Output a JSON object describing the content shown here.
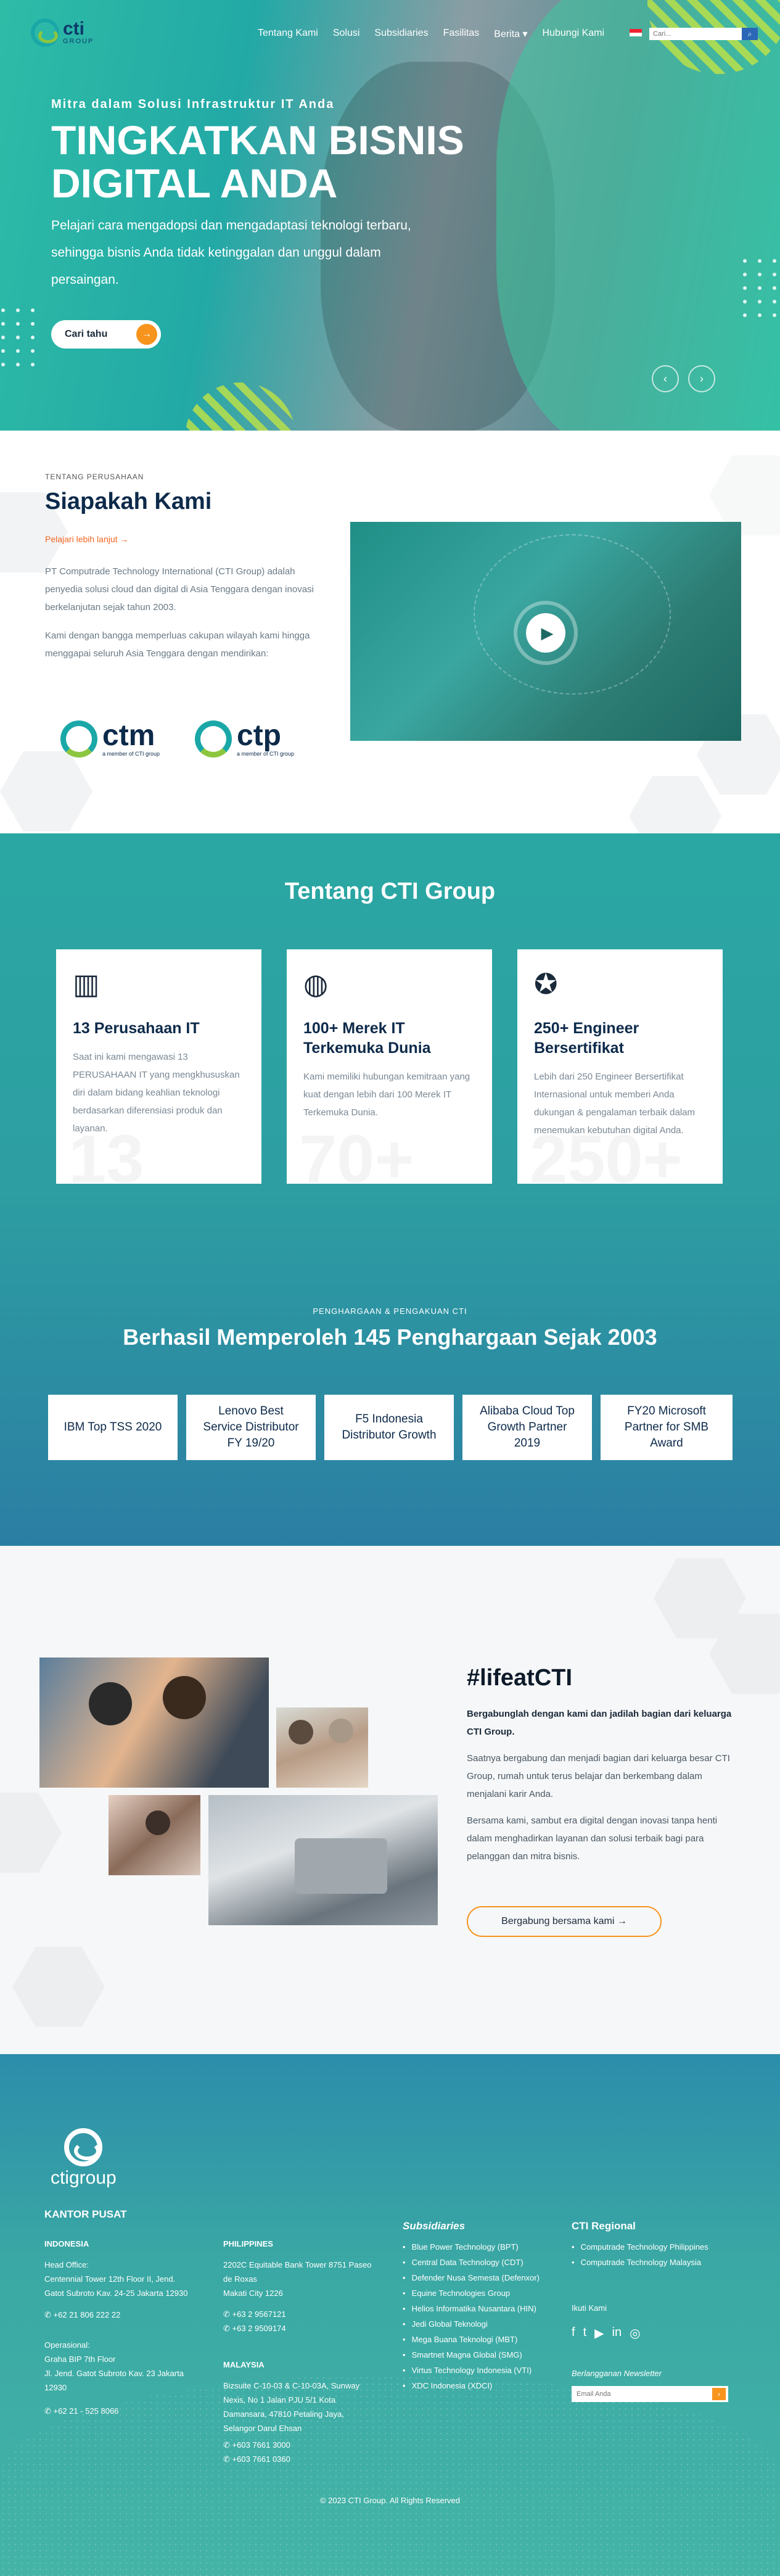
{
  "header": {
    "logo_text": "cti",
    "logo_sub": "GROUP",
    "nav": [
      "Tentang Kami",
      "Solusi",
      "Subsidiaries",
      "Fasilitas",
      "Berita ▾",
      "Hubungi Kami"
    ],
    "search_placeholder": "Cari...",
    "search_icon": "search-icon"
  },
  "hero": {
    "subtitle": "Mitra dalam Solusi Infrastruktur IT Anda",
    "title": "TINGKATKAN BISNIS DIGITAL ANDA",
    "description": "Pelajari cara mengadopsi dan mengadaptasi teknologi terbaru, sehingga bisnis Anda tidak ketinggalan dan unggul dalam persaingan.",
    "button": "Cari tahu",
    "prev": "‹",
    "next": "›"
  },
  "about": {
    "label": "TENTANG PERUSAHAAN",
    "title": "Siapakah Kami",
    "link": "Pelajari lebih lanjut  →",
    "p1": "PT Computrade Technology International (CTI Group) adalah penyedia solusi cloud dan digital di Asia Tenggara dengan inovasi berkelanjutan sejak tahun 2003.",
    "p2": "Kami dengan bangga memperluas cakupan wilayah kami hingga menggapai seluruh Asia Tenggara dengan mendirikan:",
    "logos": [
      {
        "name": "ctm",
        "sub": "a member of CTI group"
      },
      {
        "name": "ctp",
        "sub": "a member of CTI group"
      }
    ]
  },
  "stats": {
    "title": "Tentang CTI Group",
    "cards": [
      {
        "icon": "building-icon",
        "title": "13 Perusahaan IT",
        "text": "Saat ini kami mengawasi 13 PERUSAHAAN IT yang mengkhususkan diri dalam bidang keahlian teknologi berdasarkan diferensiasi produk dan layanan.",
        "bg": "13"
      },
      {
        "icon": "globe-icon",
        "title": "100+ Merek IT Terkemuka Dunia",
        "text": "Kami memiliki hubungan kemitraan yang kuat dengan lebih dari 100 Merek IT Terkemuka Dunia.",
        "bg": "70+"
      },
      {
        "icon": "award-icon",
        "title": "250+ Engineer Bersertifikat",
        "text": "Lebih dari 250 Engineer Bersertifikat Internasional untuk memberi Anda dukungan & pengalaman terbaik dalam menemukan kebutuhan digital Anda.",
        "bg": "250+"
      }
    ],
    "awards_label": "PENGHARGAAN & PENGAKUAN CTI",
    "awards_title": "Berhasil Memperoleh 145 Penghargaan Sejak 2003",
    "awards": [
      "IBM Top TSS 2020",
      "Lenovo Best Service Distributor FY 19/20",
      "F5 Indonesia Distributor Growth",
      "Alibaba Cloud Top Growth Partner 2019",
      "FY20 Microsoft Partner for SMB Award"
    ]
  },
  "life": {
    "title": "#lifeatCTI",
    "bold": "Bergabunglah dengan kami dan jadilah bagian dari keluarga CTI Group.",
    "p1": "Saatnya bergabung dan menjadi bagian dari keluarga besar CTI Group, rumah untuk terus belajar dan berkembang dalam menjalani karir Anda.",
    "p2": "Bersama kami, sambut era digital dengan inovasi tanpa henti dalam menghadirkan layanan dan solusi terbaik bagi para pelanggan dan mitra bisnis.",
    "button": "Bergabung bersama kami   →"
  },
  "footer": {
    "logo": "ctigroup",
    "kantor": "KANTOR PUSAT",
    "indonesia": {
      "label": "INDONESIA",
      "head": "Head Office:\nCentennial Tower 12th Floor II, Jend. Gatot Subroto Kav. 24-25 Jakarta 12930",
      "phone": "+62 21 806 222 22",
      "ops": "Operasional:\nGraha BIP 7th Floor\nJl. Jend. Gatot Subroto Kav. 23 Jakarta 12930",
      "phone2": "+62 21 - 525 8066"
    },
    "philippines": {
      "label": "PHILIPPINES",
      "addr": "2202C Equitable Bank Tower 8751 Paseo de Roxas\nMakati City 1226",
      "p1": "+63 2 9567121",
      "p2": "+63 2 9509174"
    },
    "malaysia": {
      "label": "MALAYSIA",
      "addr": "Bizsuite C-10-03 & C-10-03A, Sunway Nexis, No 1 Jalan PJU 5/1 Kota Damansara, 47810 Petaling Jaya, Selangor Darul Ehsan",
      "p1": "+603 7661 3000",
      "p2": "+603 7661 0360"
    },
    "subsidiaries_title": "Subsidiaries",
    "subsidiaries": [
      "Blue Power Technology (BPT)",
      "Central Data Technology (CDT)",
      "Defender Nusa Semesta (Defenxor)",
      "Equine Technologies Group",
      "Helios Informatika Nusantara (HIN)",
      "Jedi Global Teknologi",
      "Mega Buana Teknologi (MBT)",
      "Smartnet Magna Global (SMG)",
      "Virtus Technology Indonesia (VTI)",
      "XDC Indonesia (XDCI)"
    ],
    "regional_title": "CTI Regional",
    "regional": [
      "Computrade Technology Philippines",
      "Computrade Technology Malaysia"
    ],
    "follow": "Ikuti Kami",
    "social": [
      "f",
      "t",
      "▶",
      "in",
      "◎"
    ],
    "newsletter_title": "Berlangganan Newsletter",
    "newsletter_placeholder": "Email Anda",
    "copyright": "© 2023 CTI Group. All Rights Reserved"
  }
}
